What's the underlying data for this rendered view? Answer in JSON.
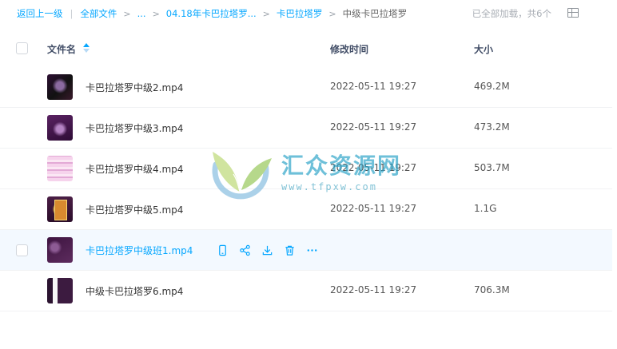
{
  "breadcrumb": {
    "back": "返回上一级",
    "separator": "|",
    "root": "全部文件",
    "ellipsis": "...",
    "folder1": "04.18年卡巴拉塔罗...",
    "folder2": "卡巴拉塔罗",
    "current": "中级卡巴拉塔罗"
  },
  "status": "已全部加载，共6个",
  "table": {
    "col_name": "文件名",
    "col_time": "修改时间",
    "col_size": "大小"
  },
  "files": [
    {
      "name": "卡巴拉塔罗中级2.mp4",
      "time": "2022-05-11 19:27",
      "size": "469.2M"
    },
    {
      "name": "卡巴拉塔罗中级3.mp4",
      "time": "2022-05-11 19:27",
      "size": "473.2M"
    },
    {
      "name": "卡巴拉塔罗中级4.mp4",
      "time": "2022-05-11 19:27",
      "size": "503.7M"
    },
    {
      "name": "卡巴拉塔罗中级5.mp4",
      "time": "2022-05-11 19:27",
      "size": "1.1G"
    },
    {
      "name": "卡巴拉塔罗中级班1.mp4",
      "time": "",
      "size": ""
    },
    {
      "name": "中级卡巴拉塔罗6.mp4",
      "time": "2022-05-11 19:27",
      "size": "706.3M"
    }
  ],
  "row_actions": [
    "phone-icon",
    "share-icon",
    "download-icon",
    "delete-icon",
    "more-icon"
  ],
  "watermark": {
    "text": "汇众资源网",
    "url": "www.tfpxw.com"
  },
  "colors": {
    "accent": "#06a7ff",
    "hover_row": "#f3f9ff"
  }
}
